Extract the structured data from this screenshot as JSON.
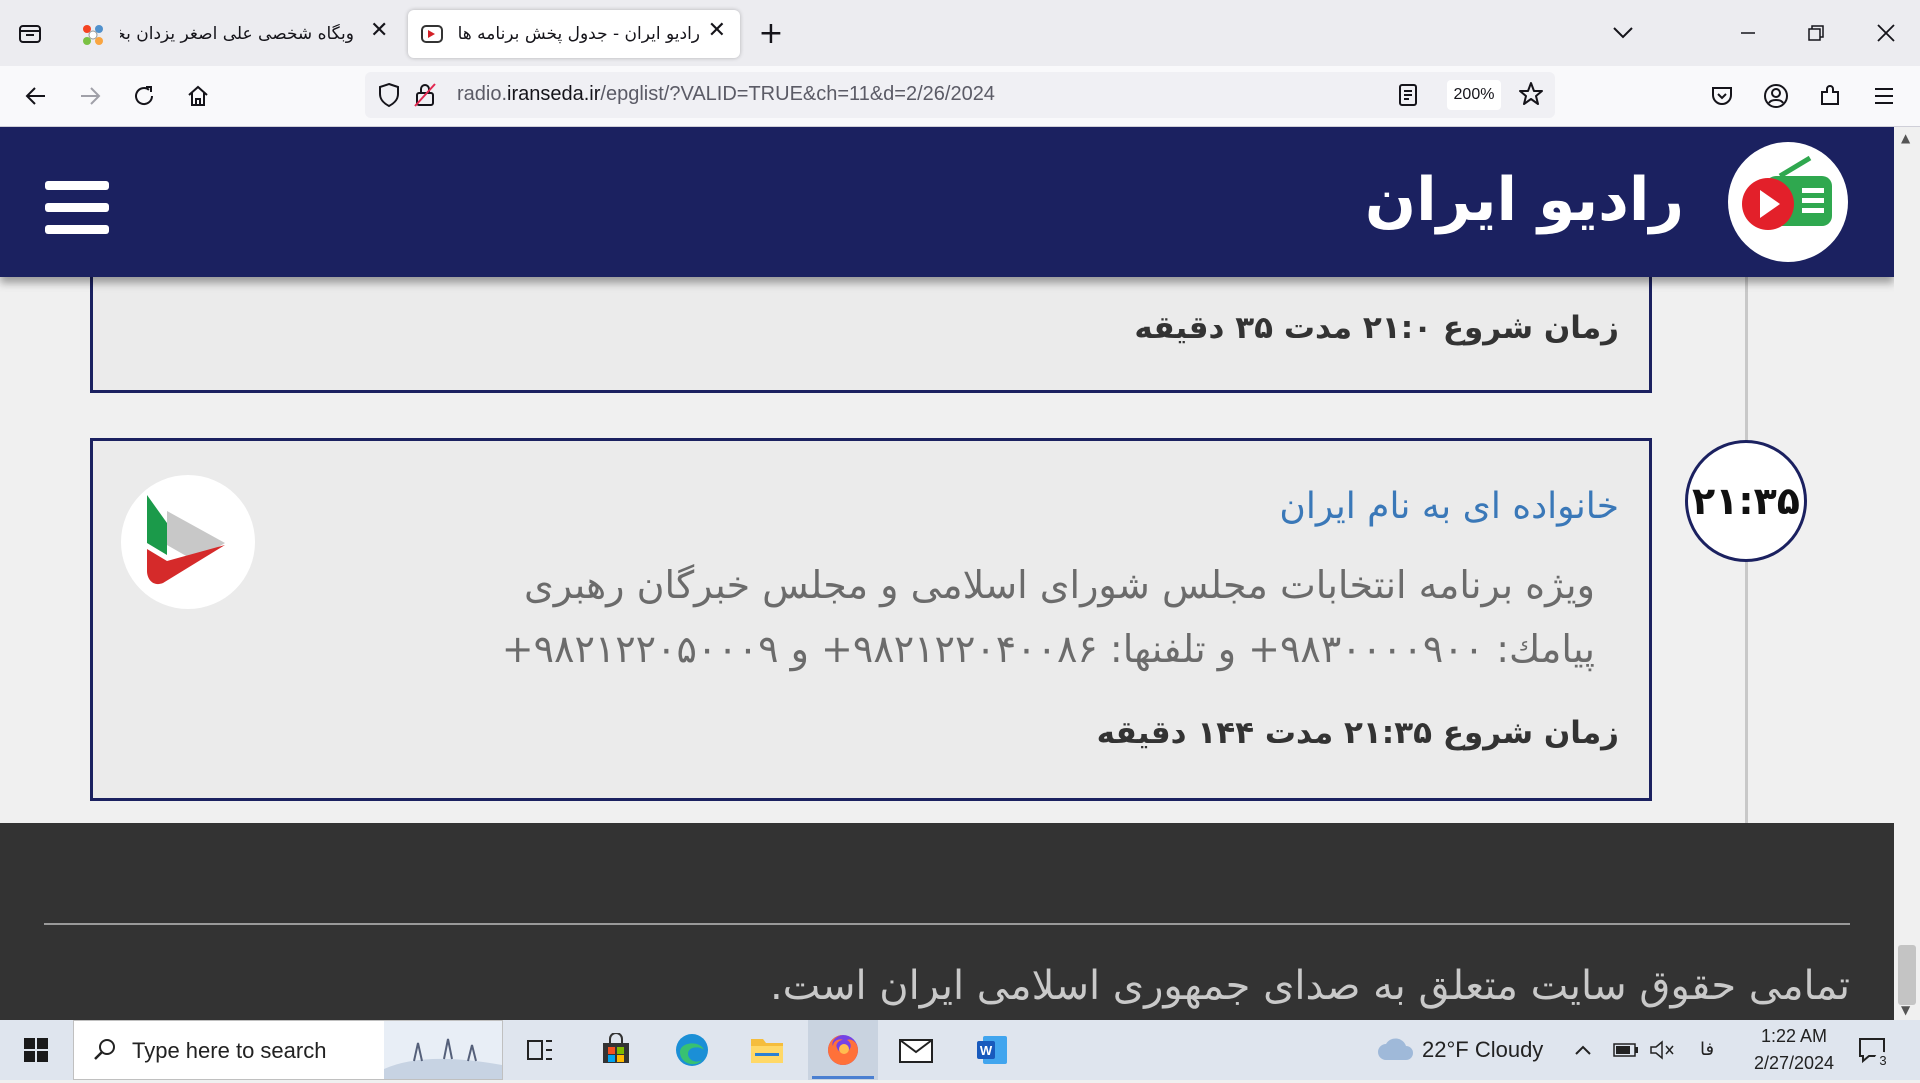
{
  "browser": {
    "tabs": [
      {
        "title": "وبگاه شخصی علی اصغر یزدان بخش -"
      },
      {
        "title": "رادیو ایران - جدول پخش برنامه ها"
      }
    ],
    "url_prefix": "radio.",
    "url_domain": "iranseda.ir",
    "url_path": "/epglist/?VALID=TRUE&ch=11&d=2/26/2024",
    "zoom": "200%"
  },
  "site": {
    "title": "رادیو ایران",
    "prev_card_start": "زمان شروع ۲۱:۰ مدت ۳۵ دقیقه",
    "program": {
      "time": "۲۱:۳۵",
      "title": "خانواده ای به نام ایران",
      "description_line1": "ویژه برنامه انتخابات مجلس شورای اسلامی و مجلس خبرگان رهبری",
      "description_line2": "پیامك: ۹۸۳۰۰۰۰۹۰۰+ و تلفنها: ۹۸۲۱۲۲۰۴۰۰۸۶+ و ۹۸۲۱۲۲۰۵۰۰۰۹+",
      "start_text": "زمان شروع ۲۱:۳۵ مدت ۱۴۴ دقیقه"
    },
    "footer_text": "تمامی حقوق سایت متعلق به صدای جمهوری اسلامی ایران است."
  },
  "taskbar": {
    "search_placeholder": "Type here to search",
    "weather": "22°F  Cloudy",
    "lang": "فا",
    "time": "1:22 AM",
    "date": "2/27/2024",
    "notification_count": "3"
  },
  "colors": {
    "header_bg": "#1b2160",
    "title_link": "#3a78b8",
    "footer_bg": "#333333"
  }
}
